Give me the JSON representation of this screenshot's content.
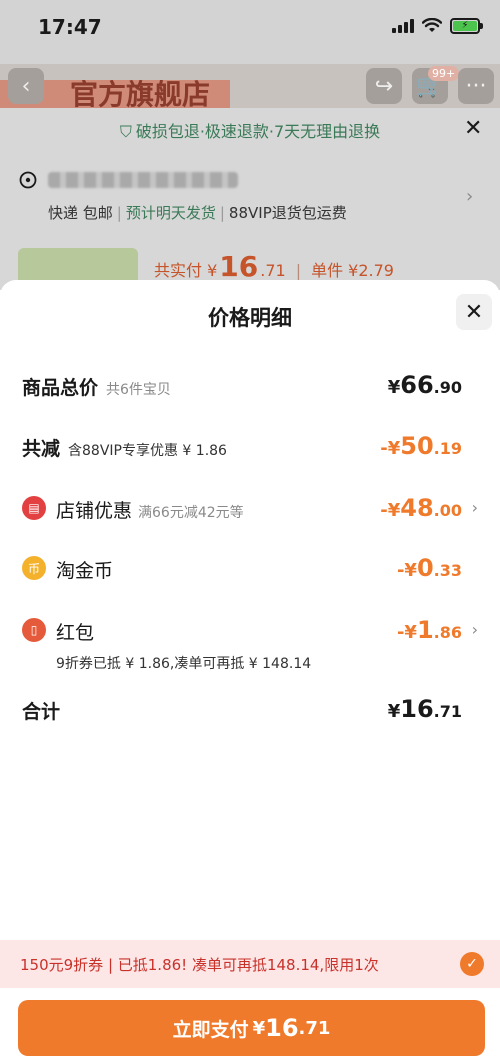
{
  "status_bar": {
    "time": "17:47"
  },
  "background": {
    "shop_name": "官方旗舰店",
    "cart_badge": "99+",
    "guarantee": "破损包退·极速退款·7天无理由退换",
    "shipping": {
      "express": "快递 包邮",
      "eta": "预计明天发货",
      "vip": "88VIP退货包运费"
    },
    "pay_summary": {
      "total_label": "共实付 ¥",
      "total_int": "16",
      "total_dec": ".71",
      "unit_label": "单件 ¥2.79"
    }
  },
  "sheet": {
    "title": "价格明细",
    "goods_total": {
      "label": "商品总价",
      "sub": "共6件宝贝",
      "cur": "¥",
      "int": "66",
      "dec": ".90"
    },
    "total_discount": {
      "label": "共减",
      "sub": "含88VIP专享优惠 ¥ 1.86",
      "cur": "-¥",
      "int": "50",
      "dec": ".19"
    },
    "shop_discount": {
      "label": "店铺优惠",
      "sub": "满66元减42元等",
      "cur": "-¥",
      "int": "48",
      "dec": ".00",
      "icon": "shop-icon"
    },
    "taojinbi": {
      "label": "淘金币",
      "cur": "-¥",
      "int": "0",
      "dec": ".33",
      "icon": "coin-icon"
    },
    "red_packet": {
      "label": "红包",
      "cur": "-¥",
      "int": "1",
      "dec": ".86",
      "note": "9折券已抵 ¥ 1.86,凑单可再抵 ¥ 148.14",
      "icon": "red-packet-icon"
    },
    "grand_total": {
      "label": "合计",
      "cur": "¥",
      "int": "16",
      "dec": ".71"
    }
  },
  "bottom": {
    "coupon_text": "150元9折券 | 已抵1.86! 凑单可再抵148.14,限用1次",
    "pay_button": {
      "label": "立即支付",
      "cur": "¥",
      "int": "16",
      "dec": ".71"
    }
  },
  "colors": {
    "accent": "#f07a2b",
    "green": "#3b7a57",
    "coupon_bg": "#fde6e6",
    "coupon_text": "#c8322a"
  }
}
